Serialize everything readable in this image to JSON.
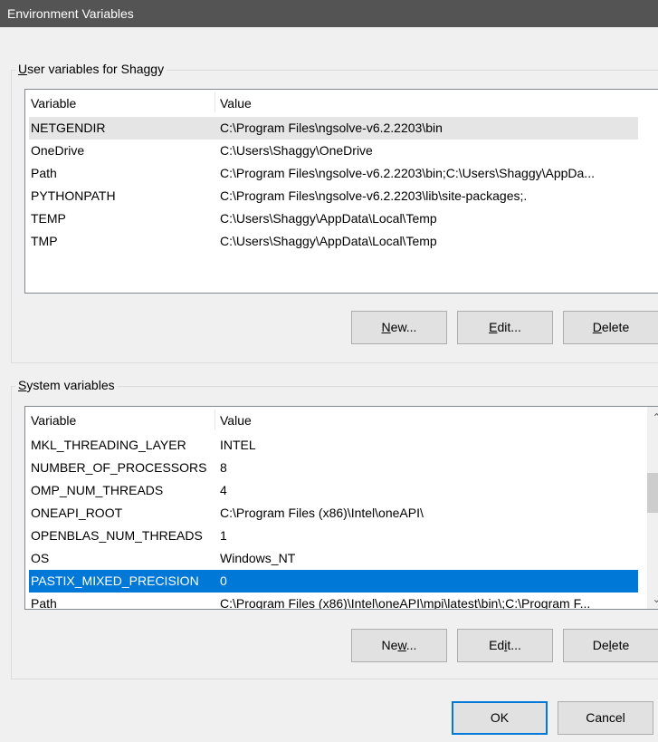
{
  "window": {
    "title": "Environment Variables"
  },
  "user_vars": {
    "group_label_prefix": "",
    "group_label_mnemonic": "U",
    "group_label_rest": "ser variables for Shaggy",
    "col_variable": "Variable",
    "col_value": "Value",
    "rows": [
      {
        "name": "NETGENDIR",
        "value": "C:\\Program Files\\ngsolve-v6.2.2203\\bin"
      },
      {
        "name": "OneDrive",
        "value": "C:\\Users\\Shaggy\\OneDrive"
      },
      {
        "name": "Path",
        "value": "C:\\Program Files\\ngsolve-v6.2.2203\\bin;C:\\Users\\Shaggy\\AppDa..."
      },
      {
        "name": "PYTHONPATH",
        "value": "C:\\Program Files\\ngsolve-v6.2.2203\\lib\\site-packages;."
      },
      {
        "name": "TEMP",
        "value": "C:\\Users\\Shaggy\\AppData\\Local\\Temp"
      },
      {
        "name": "TMP",
        "value": "C:\\Users\\Shaggy\\AppData\\Local\\Temp"
      }
    ],
    "new_pre": "",
    "new_mn": "N",
    "new_post": "ew...",
    "edit_pre": "",
    "edit_mn": "E",
    "edit_post": "dit...",
    "delete_pre": "",
    "delete_mn": "D",
    "delete_post": "elete"
  },
  "system_vars": {
    "group_label_prefix": "",
    "group_label_mnemonic": "S",
    "group_label_rest": "ystem variables",
    "col_variable": "Variable",
    "col_value": "Value",
    "rows": [
      {
        "name": "MKL_THREADING_LAYER",
        "value": "INTEL"
      },
      {
        "name": "NUMBER_OF_PROCESSORS",
        "value": "8"
      },
      {
        "name": "OMP_NUM_THREADS",
        "value": "4"
      },
      {
        "name": "ONEAPI_ROOT",
        "value": "C:\\Program Files (x86)\\Intel\\oneAPI\\"
      },
      {
        "name": "OPENBLAS_NUM_THREADS",
        "value": "1"
      },
      {
        "name": "OS",
        "value": "Windows_NT"
      },
      {
        "name": "PASTIX_MIXED_PRECISION",
        "value": "0"
      },
      {
        "name": "Path",
        "value": "C:\\Program Files (x86)\\Intel\\oneAPI\\mpi\\latest\\bin\\;C:\\Program F..."
      }
    ],
    "new_pre": "Ne",
    "new_mn": "w",
    "new_post": "...",
    "edit_pre": "Ed",
    "edit_mn": "i",
    "edit_post": "t...",
    "delete_pre": "De",
    "delete_mn": "l",
    "delete_post": "ete"
  },
  "buttons": {
    "ok": "OK",
    "cancel": "Cancel"
  },
  "colors": {
    "selection": "#0078d7",
    "hover_row": "#e5e5e5",
    "titlebar": "#545454"
  }
}
